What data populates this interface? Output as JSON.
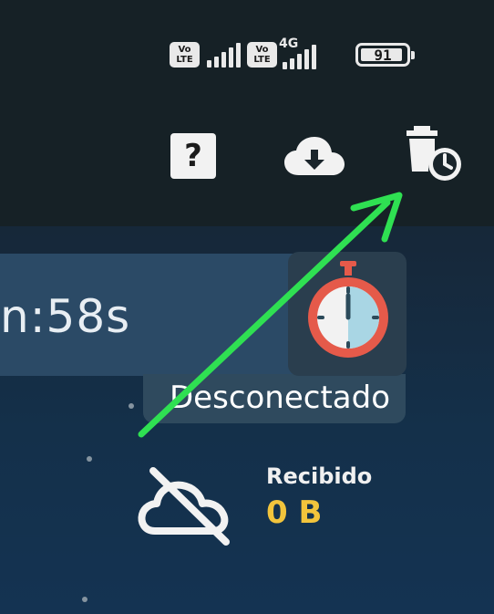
{
  "status_bar": {
    "sim1_badge": [
      "Vo",
      "LTE"
    ],
    "sim2_badge": [
      "Vo",
      "LTE"
    ],
    "network_type": "4G",
    "battery_level": "91"
  },
  "toolbar": {
    "help_icon": "question-mark-icon",
    "download_icon": "cloud-download-icon",
    "history_icon": "trash-clock-icon",
    "help_glyph": "?"
  },
  "session": {
    "timer_text": "n:58s",
    "connection_status": "Desconectado"
  },
  "traffic": {
    "received_label": "Recibido",
    "received_value": "0 B"
  },
  "annotation": {
    "arrow_color": "#2fe052"
  }
}
